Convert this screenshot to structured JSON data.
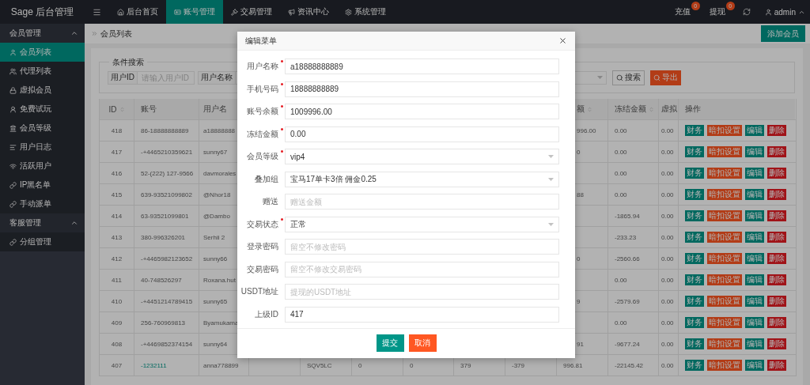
{
  "brand": "Sage 后台管理",
  "nav": {
    "tabs": [
      {
        "label": "后台首页",
        "selected": false
      },
      {
        "label": "账号管理",
        "selected": true
      },
      {
        "label": "交易管理",
        "selected": false
      },
      {
        "label": "资讯中心",
        "selected": false
      },
      {
        "label": "系统管理",
        "selected": false
      }
    ],
    "actions": [
      {
        "label": "充值",
        "badge": "0"
      },
      {
        "label": "提现",
        "badge": "0"
      }
    ],
    "user": "admin"
  },
  "sidebar": {
    "groups": [
      {
        "label": "会员管理",
        "expanded": true,
        "items": [
          {
            "label": "会员列表",
            "selected": true
          },
          {
            "label": "代理列表",
            "selected": false
          },
          {
            "label": "虚拟会员",
            "selected": false
          },
          {
            "label": "免费试玩",
            "selected": false
          },
          {
            "label": "会员等级",
            "selected": false
          },
          {
            "label": "用户日志",
            "selected": false
          },
          {
            "label": "活跃用户",
            "selected": false
          },
          {
            "label": "IP黑名单",
            "selected": false
          },
          {
            "label": "手动派单",
            "selected": false
          }
        ]
      },
      {
        "label": "客服管理",
        "expanded": true,
        "items": [
          {
            "label": "分组管理",
            "selected": false
          }
        ]
      }
    ]
  },
  "breadcrumb": "会员列表",
  "add_button": "添加会员",
  "search": {
    "legend": "条件搜索",
    "fields": [
      {
        "label": "用户ID",
        "placeholder": "请输入用户ID"
      },
      {
        "label": "用户名称"
      }
    ],
    "buttons": [
      {
        "label": "搜索",
        "kind": "plain"
      },
      {
        "label": "导出",
        "kind": "warm"
      }
    ]
  },
  "table": {
    "columns": [
      {
        "label": "ID",
        "sortable": true
      },
      {
        "label": "账号",
        "sortable": false
      },
      {
        "label": "用户名",
        "sortable": false
      },
      {},
      {},
      {},
      {},
      {},
      {},
      {
        "label": "额",
        "sortable": true,
        "clipped": true
      },
      {
        "label": "冻结金额",
        "sortable": true
      },
      {
        "label": "虚拟"
      },
      {
        "label": "操作",
        "sortable": false
      }
    ],
    "rows": [
      {
        "cells": [
          {
            "text": "418"
          },
          {
            "text": "86-18888888889",
            "link": false
          },
          {
            "text": "a18888888"
          },
          {},
          {},
          {},
          {},
          {},
          {},
          {
            "text": "996.00",
            "clipped": true
          },
          {
            "text": "0.00"
          },
          {
            "text": "0.00"
          }
        ],
        "actions": [
          {
            "label": "财务",
            "kind": "finance"
          },
          {
            "label": "暗扣设置",
            "kind": "setting"
          },
          {
            "label": "编辑",
            "kind": "edit"
          },
          {
            "label": "删除",
            "kind": "delete"
          }
        ]
      },
      {
        "cells": [
          {
            "text": "417"
          },
          {
            "text": "-+4465210359621",
            "link": false
          },
          {
            "text": "sunny67"
          },
          {},
          {},
          {},
          {},
          {},
          {},
          {
            "text": "0",
            "clipped": true
          },
          {
            "text": "0.00"
          },
          {
            "text": "0.00"
          }
        ],
        "actions": [
          {
            "label": "财务",
            "kind": "finance"
          },
          {
            "label": "暗扣设置",
            "kind": "setting"
          },
          {
            "label": "编辑",
            "kind": "edit"
          },
          {
            "label": "删除",
            "kind": "delete"
          }
        ]
      },
      {
        "cells": [
          {
            "text": "416"
          },
          {
            "text": "52-(222) 127-9566",
            "link": false
          },
          {
            "text": "davmorales"
          },
          {},
          {},
          {},
          {},
          {},
          {},
          {},
          {
            "text": "0.00"
          },
          {
            "text": "0.00"
          }
        ],
        "actions": [
          {
            "label": "财务",
            "kind": "finance"
          },
          {
            "label": "暗扣设置",
            "kind": "setting"
          },
          {
            "label": "编辑",
            "kind": "edit"
          },
          {
            "label": "删除",
            "kind": "delete"
          }
        ]
      },
      {
        "cells": [
          {
            "text": "415"
          },
          {
            "text": "639-93521099802",
            "link": false
          },
          {
            "text": "@Nhor18"
          },
          {},
          {},
          {},
          {},
          {},
          {},
          {
            "text": "88",
            "clipped": true
          },
          {
            "text": "0.00"
          },
          {
            "text": "0.00"
          }
        ],
        "actions": [
          {
            "label": "财务",
            "kind": "finance"
          },
          {
            "label": "暗扣设置",
            "kind": "setting"
          },
          {
            "label": "编辑",
            "kind": "edit"
          },
          {
            "label": "删除",
            "kind": "delete"
          }
        ]
      },
      {
        "cells": [
          {
            "text": "414"
          },
          {
            "text": "63-93521099801",
            "link": false
          },
          {
            "text": "@Dambo"
          },
          {},
          {},
          {},
          {},
          {},
          {},
          {},
          {
            "text": "-1865.94"
          },
          {
            "text": "0.00"
          }
        ],
        "actions": [
          {
            "label": "财务",
            "kind": "finance"
          },
          {
            "label": "暗扣设置",
            "kind": "setting"
          },
          {
            "label": "编辑",
            "kind": "edit"
          },
          {
            "label": "删除",
            "kind": "delete"
          }
        ]
      },
      {
        "cells": [
          {
            "text": "413"
          },
          {
            "text": "380-996326201",
            "link": false
          },
          {
            "text": "Serhii 2"
          },
          {},
          {},
          {},
          {},
          {},
          {},
          {},
          {
            "text": "-233.23"
          },
          {
            "text": "0.00"
          }
        ],
        "actions": [
          {
            "label": "财务",
            "kind": "finance"
          },
          {
            "label": "暗扣设置",
            "kind": "setting"
          },
          {
            "label": "编辑",
            "kind": "edit"
          },
          {
            "label": "删除",
            "kind": "delete"
          }
        ]
      },
      {
        "cells": [
          {
            "text": "412"
          },
          {
            "text": "-+4465982123652",
            "link": false
          },
          {
            "text": "sunny66"
          },
          {},
          {},
          {},
          {},
          {},
          {},
          {
            "text": "0",
            "clipped": true
          },
          {
            "text": "-2560.66"
          },
          {
            "text": "0.00"
          }
        ],
        "actions": [
          {
            "label": "财务",
            "kind": "finance"
          },
          {
            "label": "暗扣设置",
            "kind": "setting"
          },
          {
            "label": "编辑",
            "kind": "edit"
          },
          {
            "label": "删除",
            "kind": "delete"
          }
        ]
      },
      {
        "cells": [
          {
            "text": "411"
          },
          {
            "text": "40-748526297",
            "link": false
          },
          {
            "text": "Roxana.hut"
          },
          {},
          {},
          {},
          {},
          {},
          {},
          {},
          {
            "text": "0.00"
          },
          {
            "text": "0.00"
          }
        ],
        "actions": [
          {
            "label": "财务",
            "kind": "finance"
          },
          {
            "label": "暗扣设置",
            "kind": "setting"
          },
          {
            "label": "编辑",
            "kind": "edit"
          },
          {
            "label": "删除",
            "kind": "delete"
          }
        ]
      },
      {
        "cells": [
          {
            "text": "410"
          },
          {
            "text": "-+4451214789415",
            "link": false
          },
          {
            "text": "sunny65"
          },
          {},
          {},
          {},
          {},
          {},
          {},
          {
            "text": "9",
            "clipped": true
          },
          {
            "text": "-2579.69"
          },
          {
            "text": "0.00"
          }
        ],
        "actions": [
          {
            "label": "财务",
            "kind": "finance"
          },
          {
            "label": "暗扣设置",
            "kind": "setting"
          },
          {
            "label": "编辑",
            "kind": "edit"
          },
          {
            "label": "删除",
            "kind": "delete"
          }
        ]
      },
      {
        "cells": [
          {
            "text": "409"
          },
          {
            "text": "256-760969813",
            "link": false
          },
          {
            "text": "Byamukama"
          },
          {},
          {},
          {},
          {},
          {},
          {},
          {},
          {
            "text": "0.00"
          },
          {
            "text": "0.00"
          }
        ],
        "actions": [
          {
            "label": "财务",
            "kind": "finance"
          },
          {
            "label": "暗扣设置",
            "kind": "setting"
          },
          {
            "label": "编辑",
            "kind": "edit"
          },
          {
            "label": "删除",
            "kind": "delete"
          }
        ]
      },
      {
        "cells": [
          {
            "text": "408"
          },
          {
            "text": "-+4469852374154",
            "link": false
          },
          {
            "text": "sunny64"
          },
          {},
          {},
          {},
          {},
          {},
          {},
          {
            "text": "91",
            "clipped": true
          },
          {
            "text": "-9677.24"
          },
          {
            "text": "0.00"
          }
        ],
        "actions": [
          {
            "label": "财务",
            "kind": "finance"
          },
          {
            "label": "暗扣设置",
            "kind": "setting"
          },
          {
            "label": "编辑",
            "kind": "edit"
          },
          {
            "label": "删除",
            "kind": "delete"
          }
        ]
      },
      {
        "cells": [
          {
            "text": "407"
          },
          {
            "text": "-1232111",
            "link": true
          },
          {
            "text": "anna778899"
          },
          {},
          {
            "text": "SQV5LC"
          },
          {
            "text": "0"
          },
          {
            "text": "0"
          },
          {
            "text": "379"
          },
          {
            "text": "-379"
          },
          {
            "text": "996.81"
          },
          {
            "text": "-22145.42"
          },
          {
            "text": "0.00"
          }
        ],
        "actions": [
          {
            "label": "财务",
            "kind": "finance"
          },
          {
            "label": "暗扣设置",
            "kind": "setting"
          },
          {
            "label": "编辑",
            "kind": "edit"
          },
          {
            "label": "删除",
            "kind": "delete"
          }
        ]
      }
    ]
  },
  "modal": {
    "title": "编辑菜单",
    "fields": [
      {
        "label": "用户名称",
        "required": true,
        "kind": "input",
        "value": "a18888888889"
      },
      {
        "label": "手机号码",
        "required": true,
        "kind": "input",
        "value": "18888888889"
      },
      {
        "label": "账号余额",
        "required": true,
        "kind": "input",
        "value": "1009996.00"
      },
      {
        "label": "冻结金额",
        "required": true,
        "kind": "input",
        "value": "0.00"
      },
      {
        "label": "会员等级",
        "required": true,
        "kind": "select",
        "value": "vip4"
      },
      {
        "label": "叠加组",
        "required": false,
        "kind": "select",
        "value": "宝马17单卡3倍 佣金0.25"
      },
      {
        "label": "赠送",
        "required": false,
        "kind": "input",
        "placeholder": "赠送金额"
      },
      {
        "label": "交易状态",
        "required": true,
        "kind": "select",
        "value": "正常"
      },
      {
        "label": "登录密码",
        "required": false,
        "kind": "input",
        "placeholder": "留空不修改密码"
      },
      {
        "label": "交易密码",
        "required": false,
        "kind": "input",
        "placeholder": "留空不修改交易密码"
      },
      {
        "label": "USDT地址",
        "required": false,
        "kind": "input",
        "placeholder": "提现的USDT地址"
      },
      {
        "label": "上级ID",
        "required": false,
        "kind": "input",
        "value": "417"
      }
    ],
    "buttons": [
      {
        "label": "提交",
        "kind": "primary"
      },
      {
        "label": "取消",
        "kind": "warm"
      }
    ]
  }
}
